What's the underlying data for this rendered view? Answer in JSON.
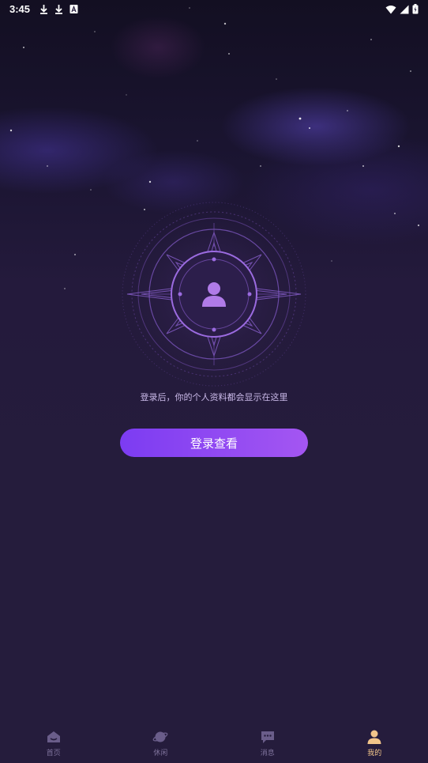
{
  "status_bar": {
    "time": "3:45",
    "left_icons": [
      "download-icon",
      "download-icon",
      "font-icon"
    ],
    "right_icons": [
      "wifi-icon",
      "signal-icon",
      "battery-charging-icon"
    ]
  },
  "profile": {
    "avatar_icon": "person-icon",
    "hint": "登录后，你的个人资料都会显示在这里",
    "login_button": "登录查看"
  },
  "tabbar": {
    "active_tab": 3,
    "tabs": [
      {
        "label": "首页",
        "icon": "home-icon"
      },
      {
        "label": "休闲",
        "icon": "planet-icon"
      },
      {
        "label": "消息",
        "icon": "chat-icon"
      },
      {
        "label": "我的",
        "icon": "user-icon"
      }
    ]
  },
  "colors": {
    "background": "#251c3c",
    "button_start": "#7c3cf2",
    "button_end": "#a456f2",
    "tab_inactive": "#7f739c",
    "tab_active": "#f2c58a",
    "emblem": "#9b6be0"
  }
}
